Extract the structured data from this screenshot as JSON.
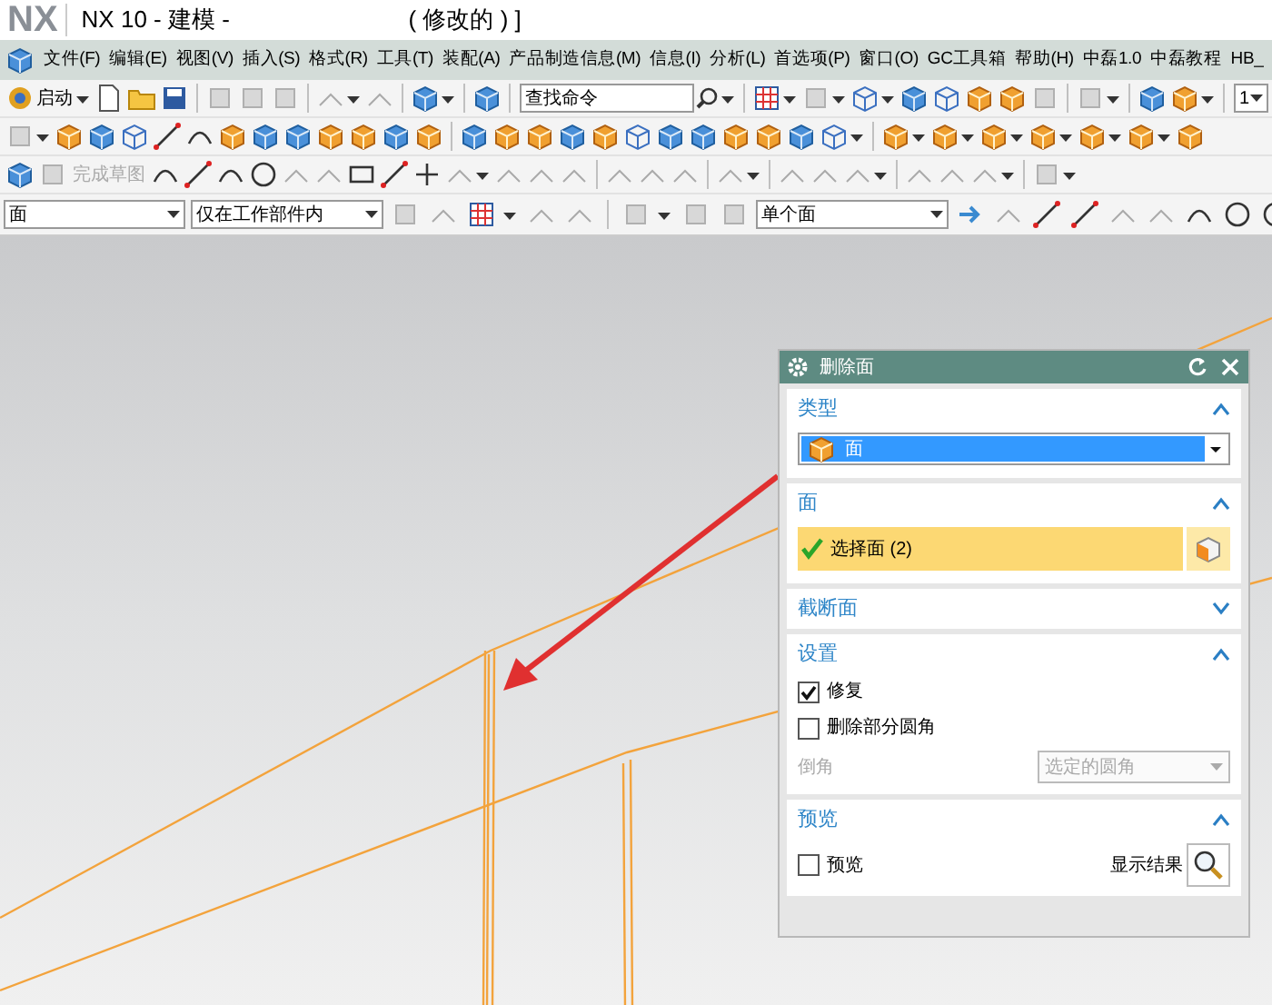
{
  "window": {
    "logo": "NX",
    "title": "NX 10 - 建模 -",
    "title_suffix": "( 修改的 ) ]"
  },
  "menu": [
    "文件(F)",
    "编辑(E)",
    "视图(V)",
    "插入(S)",
    "格式(R)",
    "工具(T)",
    "装配(A)",
    "产品制造信息(M)",
    "信息(I)",
    "分析(L)",
    "首选项(P)",
    "窗口(O)",
    "GC工具箱",
    "帮助(H)",
    "中磊1.0",
    "中磊教程",
    "HB_"
  ],
  "toolbar": {
    "start_button": "启动",
    "search": {
      "placeholder": "查找命令"
    },
    "layer_value": "1",
    "sketch_finish": {
      "label": "完成草图",
      "disabled": true
    }
  },
  "selection_bar": {
    "filter": "面",
    "scope": "仅在工作部件内",
    "face_rule": "单个面"
  },
  "dialog": {
    "title": "删除面",
    "sections": [
      {
        "kind": "type",
        "title": "类型",
        "expanded": true,
        "value": "面"
      },
      {
        "kind": "selection",
        "title": "面",
        "expanded": true,
        "label": "选择面 (2)",
        "done": true
      },
      {
        "title": "截断面",
        "expanded": false
      },
      {
        "kind": "settings",
        "title": "设置",
        "expanded": true,
        "checks": [
          {
            "label": "修复",
            "checked": true
          },
          {
            "label": "删除部分圆角",
            "checked": false
          }
        ],
        "field": {
          "label": "倒角",
          "value": "选定的圆角",
          "disabled": true
        }
      },
      {
        "kind": "preview",
        "title": "预览",
        "expanded": true,
        "check": {
          "label": "预览",
          "checked": false
        },
        "button": "显示结果"
      }
    ]
  }
}
